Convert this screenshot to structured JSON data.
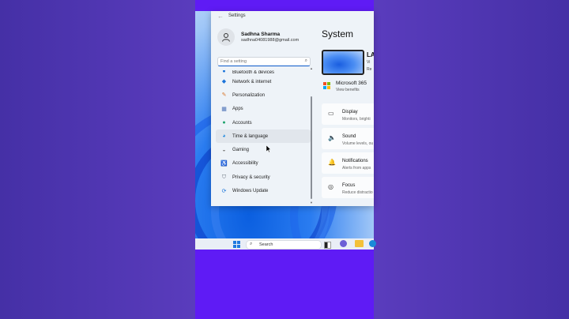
{
  "window": {
    "title": "Settings",
    "back_icon": "back-arrow-icon"
  },
  "user": {
    "name": "Sadhna Sharma",
    "email": "sadhna04081988@gmail.com"
  },
  "search": {
    "placeholder": "Find a setting"
  },
  "nav": {
    "items": [
      {
        "label": "Bluetooth & devices",
        "icon": "bluetooth-icon",
        "color": "#1a73d9"
      },
      {
        "label": "Network & internet",
        "icon": "wifi-icon",
        "color": "#1a73d9"
      },
      {
        "label": "Personalization",
        "icon": "brush-icon",
        "color": "#d8762a"
      },
      {
        "label": "Apps",
        "icon": "apps-icon",
        "color": "#4a6fb5"
      },
      {
        "label": "Accounts",
        "icon": "person-icon",
        "color": "#1ea36d"
      },
      {
        "label": "Time & language",
        "icon": "globe-icon",
        "color": "#2a8ee0",
        "active": true
      },
      {
        "label": "Gaming",
        "icon": "gamepad-icon",
        "color": "#888888"
      },
      {
        "label": "Accessibility",
        "icon": "accessibility-icon",
        "color": "#1a73d9"
      },
      {
        "label": "Privacy & security",
        "icon": "shield-icon",
        "color": "#6b7480"
      },
      {
        "label": "Windows Update",
        "icon": "update-icon",
        "color": "#1a73d9"
      }
    ]
  },
  "main": {
    "title": "System",
    "device": {
      "name": "LA",
      "line1": "Vi",
      "line2": "Re"
    },
    "m365": {
      "title": "Microsoft 365",
      "subtitle": "View benefits"
    },
    "cards": [
      {
        "title": "Display",
        "subtitle": "Monitors, brighti",
        "icon": "display-icon"
      },
      {
        "title": "Sound",
        "subtitle": "Volume levels, ou",
        "icon": "sound-icon"
      },
      {
        "title": "Notifications",
        "subtitle": "Alerts from apps",
        "icon": "bell-icon"
      },
      {
        "title": "Focus",
        "subtitle": "Reduce distractio",
        "icon": "focus-icon"
      }
    ]
  },
  "taskbar": {
    "search_label": "Search"
  },
  "colors": {
    "background": "#4a2fb0",
    "accent": "#0a59c9",
    "purple_band": "#5f1bf5"
  }
}
